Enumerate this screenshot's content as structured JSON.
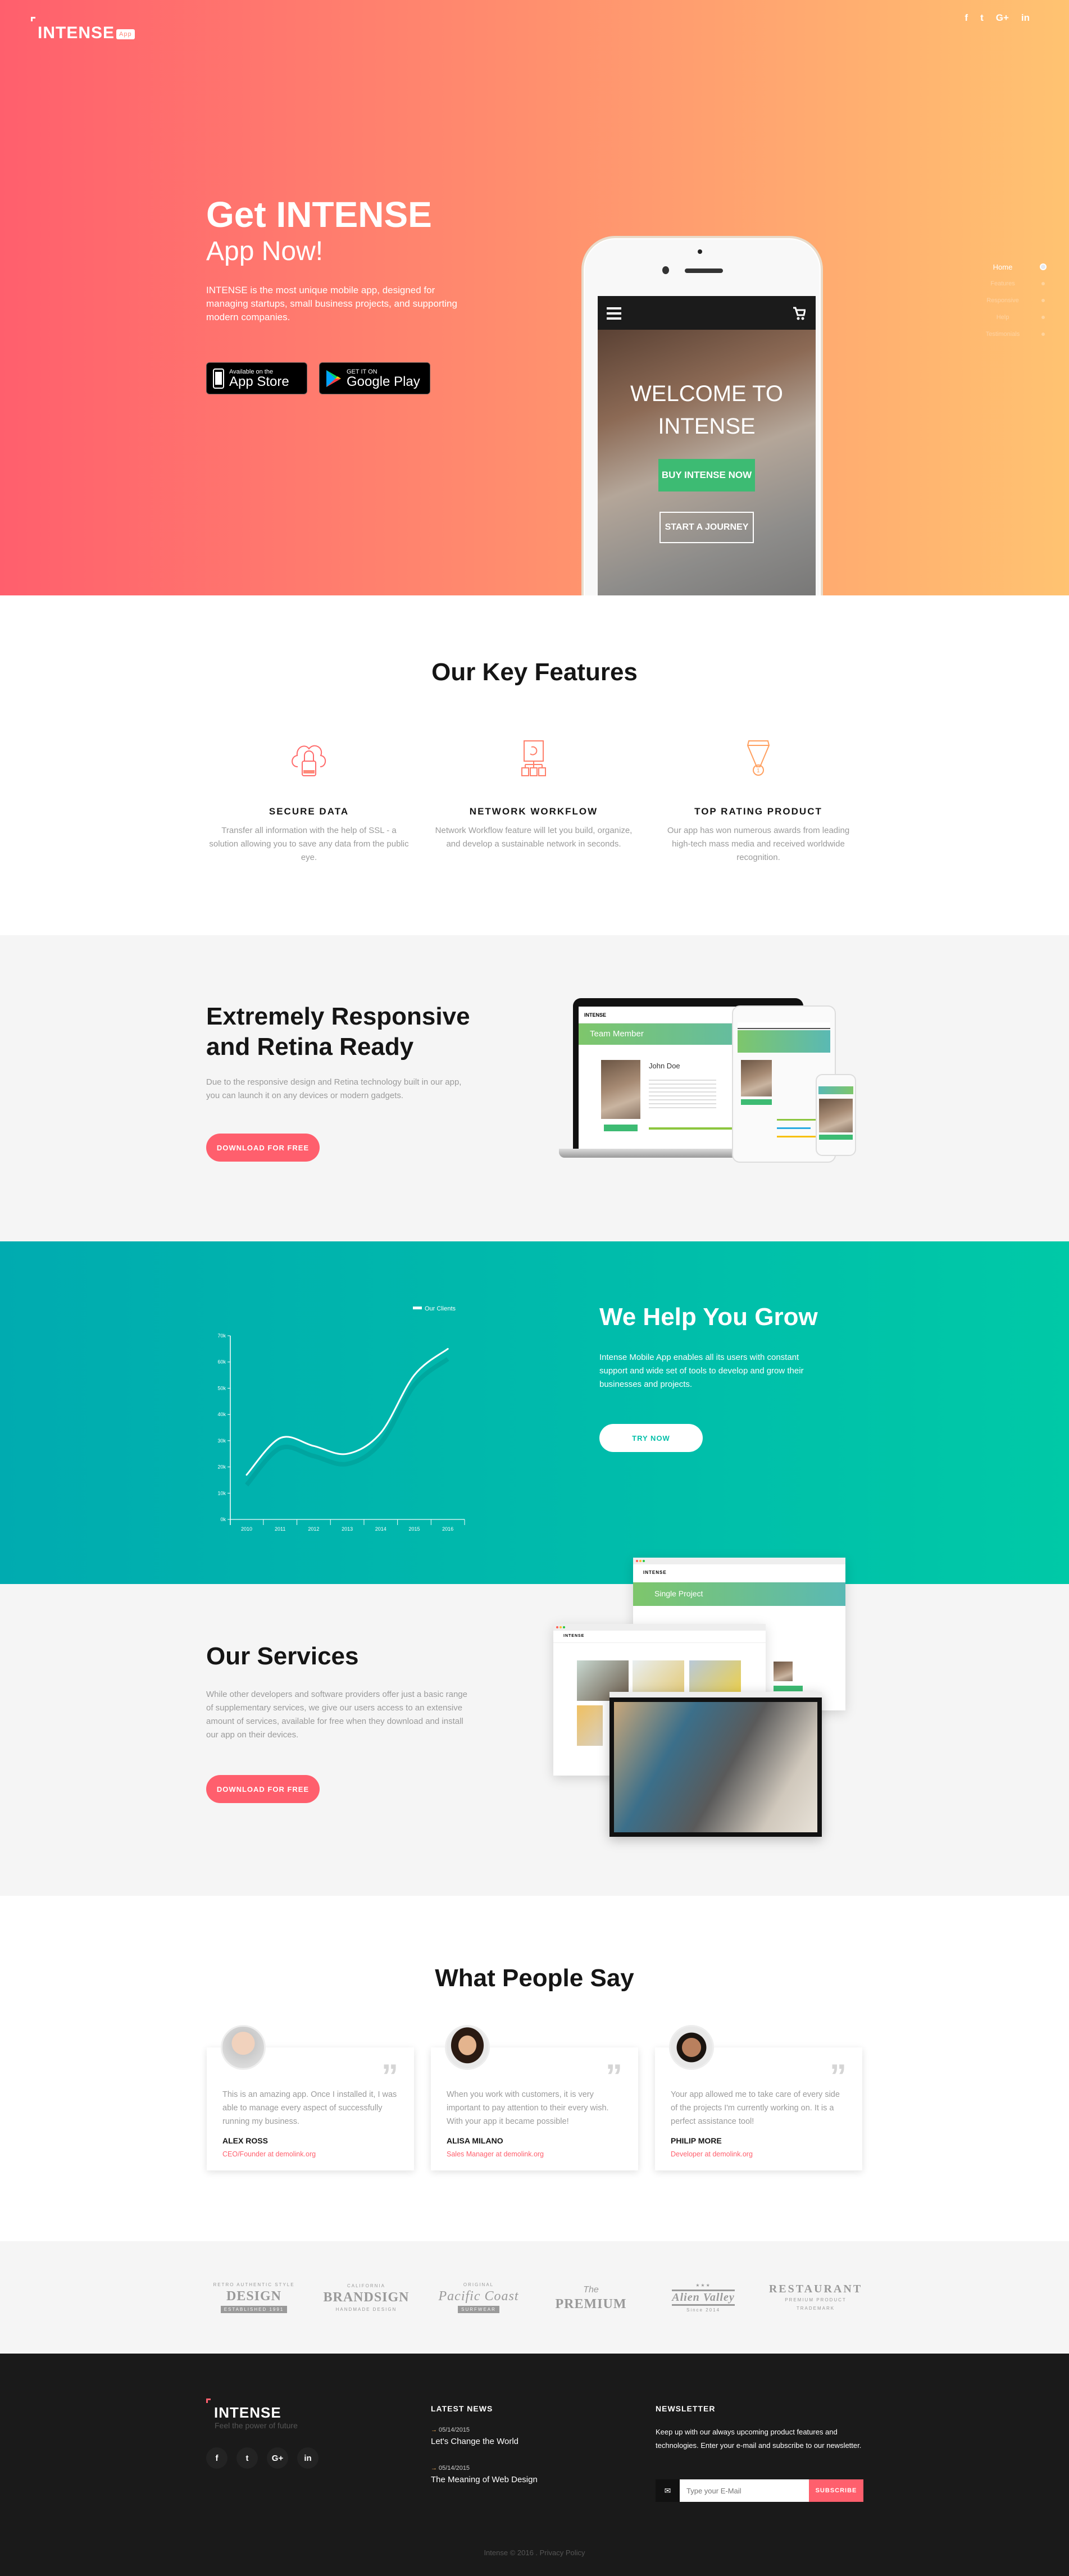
{
  "colors": {
    "hero_from": "#ff5f6d",
    "hero_to": "#ffc371",
    "accent": "#ff5f6d",
    "teal_from": "#00abb0",
    "teal_to": "#00c9a7",
    "green": "#3dbb73",
    "footer_bg": "#1a1a1a"
  },
  "header": {
    "logo": "INTENSE",
    "logo_badge": "App",
    "social": [
      {
        "icon": "facebook-icon",
        "glyph": "f"
      },
      {
        "icon": "twitter-icon",
        "glyph": "t"
      },
      {
        "icon": "google-plus-icon",
        "glyph": "G+"
      },
      {
        "icon": "linkedin-icon",
        "glyph": "in"
      }
    ]
  },
  "side_nav": {
    "items": [
      {
        "label": "Home",
        "active": true
      },
      {
        "label": "Features"
      },
      {
        "label": "Responsive"
      },
      {
        "label": "Help"
      },
      {
        "label": "Testimonials"
      }
    ]
  },
  "hero": {
    "title": "Get INTENSE",
    "subtitle": "App Now!",
    "text": "INTENSE is the most unique mobile app, designed for managing startups, small business projects, and supporting modern companies.",
    "app_store": {
      "line1": "Available on the",
      "line2": "App Store"
    },
    "google_play": {
      "line1": "GET IT ON",
      "line2": "Google Play"
    },
    "phone": {
      "welcome_line1": "WELCOME TO",
      "welcome_line2": "INTENSE",
      "buy_label": "BUY INTENSE NOW",
      "journey_label": "START A JOURNEY"
    }
  },
  "features": {
    "title": "Our Key Features",
    "items": [
      {
        "icon": "cloud-lock-icon",
        "title": "SECURE DATA",
        "text": "Transfer all information with the help of SSL - a solution allowing you to save any data from the public eye."
      },
      {
        "icon": "network-folders-icon",
        "title": "NETWORK WORKFLOW",
        "text": "Network Workflow feature will let you build, organize, and develop a sustainable network in seconds."
      },
      {
        "icon": "medal-icon",
        "title": "TOP RATING PRODUCT",
        "text": "Our app has won numerous awards from leading high-tech mass media and received worldwide recognition."
      }
    ]
  },
  "responsive": {
    "title_line1": "Extremely Responsive",
    "title_line2": "and Retina Ready",
    "text": "Due to the responsive design and Retina technology built in our app, you can launch it on any devices or modern gadgets.",
    "button": "DOWNLOAD FOR FREE",
    "mock": {
      "logo": "INTENSE",
      "band": "Team Member",
      "name": "John Doe"
    }
  },
  "grow": {
    "title": "We Help You Grow",
    "text": "Intense Mobile App enables all its users with constant support and wide set of tools to develop and grow their businesses and projects.",
    "button": "TRY NOW"
  },
  "chart_data": {
    "type": "line",
    "legend": "Our Clients",
    "legend_placement": "top-right",
    "categories": [
      "2010",
      "2011",
      "2012",
      "2013",
      "2014",
      "2015",
      "2016"
    ],
    "series": [
      {
        "name": "Our Clients",
        "values": [
          17000,
          31000,
          28000,
          25000,
          33000,
          55000,
          65000
        ]
      }
    ],
    "yticks": [
      "0k",
      "10k",
      "20k",
      "30k",
      "40k",
      "50k",
      "60k",
      "70k"
    ],
    "ylim": [
      0,
      70000
    ],
    "smooth": true,
    "grid": false
  },
  "services": {
    "title": "Our Services",
    "text": "While other developers and software providers offer just a basic range of supplementary services, we give our users access to an extensive amount of services, available for free when they download and install our app on their devices.",
    "button": "DOWNLOAD FOR FREE",
    "mock": {
      "logo": "INTENSE",
      "band": "Single Project"
    }
  },
  "testimonials": {
    "title": "What People Say",
    "items": [
      {
        "text": "This is an amazing app. Once I installed it, I was able to manage every aspect of successfully running my business.",
        "name": "ALEX ROSS",
        "role": "CEO/Founder at demolink.org"
      },
      {
        "text": "When you work with customers, it is very important to pay attention to their every wish. With your app it became possible!",
        "name": "ALISA MILANO",
        "role": "Sales Manager at demolink.org"
      },
      {
        "text": "Your app allowed me to take care of every side of the projects I'm currently working on. It is a perfect assistance tool!",
        "name": "PHILIP MORE",
        "role": "Developer at demolink.org"
      }
    ]
  },
  "partners": [
    {
      "main": "DESIGN",
      "small": "RETRO AUTHENTIC STYLE",
      "sub": "ESTABLISHED 1991"
    },
    {
      "main": "BRANDSIGN",
      "small": "CALIFORNIA",
      "sub": "HANDMADE DESIGN"
    },
    {
      "main": "Pacific Coast",
      "small": "ORIGINAL",
      "sub": "SURFWEAR"
    },
    {
      "main": "PREMIUM",
      "small": "The",
      "sub": ""
    },
    {
      "main": "Alien Valley",
      "small": "★★★",
      "sub": "Since 2014"
    },
    {
      "main": "RESTAURANT",
      "small": "PREMIUM PRODUCT",
      "sub": "TRADEMARK"
    }
  ],
  "footer": {
    "logo": "INTENSE",
    "tagline": "Feel the power of future",
    "social": [
      {
        "icon": "facebook-icon",
        "glyph": "f"
      },
      {
        "icon": "twitter-icon",
        "glyph": "t"
      },
      {
        "icon": "google-plus-icon",
        "glyph": "G+"
      },
      {
        "icon": "linkedin-icon",
        "glyph": "in"
      }
    ],
    "news_title": "LATEST NEWS",
    "news": [
      {
        "date": "05/14/2015",
        "title": "Let's Change the World"
      },
      {
        "date": "05/14/2015",
        "title": "The Meaning of Web Design"
      }
    ],
    "newsletter_title": "NEWSLETTER",
    "newsletter_text": "Keep up with our always upcoming product features and technologies. Enter your e-mail and subscribe to our newsletter.",
    "email_placeholder": "Type your E-Mail",
    "subscribe": "SUBSCRIBE",
    "copyright": "Intense © 2016 . Privacy Policy"
  }
}
